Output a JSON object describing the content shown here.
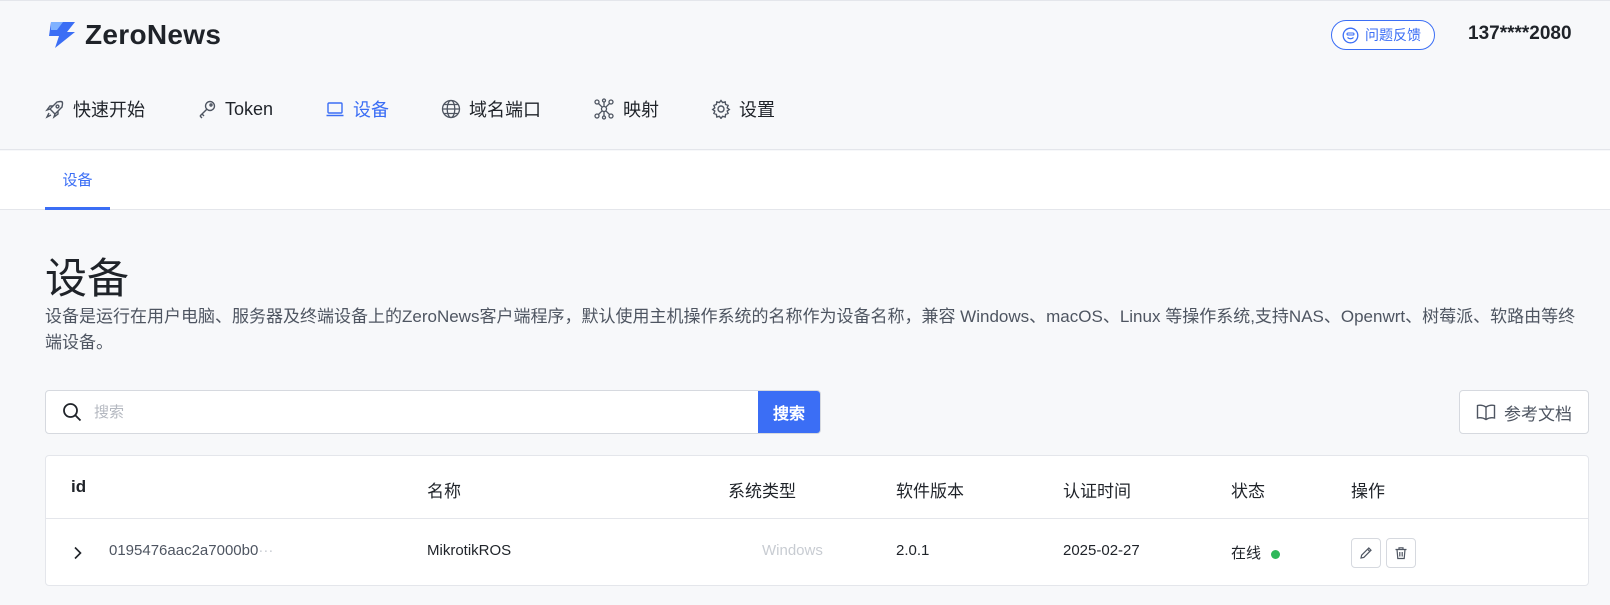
{
  "app": {
    "brand": "ZeroNews",
    "feedback_label": "问题反馈",
    "user_phone": "137****2080"
  },
  "nav": {
    "items": [
      {
        "label": "快速开始",
        "icon": "rocket-icon"
      },
      {
        "label": "Token",
        "icon": "key-icon"
      },
      {
        "label": "设备",
        "icon": "laptop-icon",
        "active": true
      },
      {
        "label": "域名端口",
        "icon": "globe-icon"
      },
      {
        "label": "映射",
        "icon": "network-icon"
      },
      {
        "label": "设置",
        "icon": "gear-icon"
      }
    ]
  },
  "subnav": {
    "tabs": [
      {
        "label": "设备",
        "active": true
      }
    ]
  },
  "page": {
    "title": "设备",
    "description": "设备是运行在用户电脑、服务器及终端设备上的ZeroNews客户端程序，默认使用主机操作系统的名称作为设备名称，兼容 Windows、macOS、Linux 等操作系统,支持NAS、Openwrt、树莓派、软路由等终端设备。"
  },
  "search": {
    "placeholder": "搜索",
    "value": "",
    "button_label": "搜索"
  },
  "docs_button_label": "参考文档",
  "table": {
    "columns": [
      "id",
      "名称",
      "系统类型",
      "软件版本",
      "认证时间",
      "状态",
      "操作"
    ],
    "rows": [
      {
        "id": "0195476aac2a7000b0",
        "name": "MikrotikROS",
        "os": "Windows",
        "version": "2.0.1",
        "auth_time": "2025-02-27",
        "status": "在线"
      }
    ]
  },
  "colors": {
    "accent": "#3b6ef5",
    "online": "#2fb85a",
    "text": "#1f2329",
    "muted": "#4e5561"
  }
}
